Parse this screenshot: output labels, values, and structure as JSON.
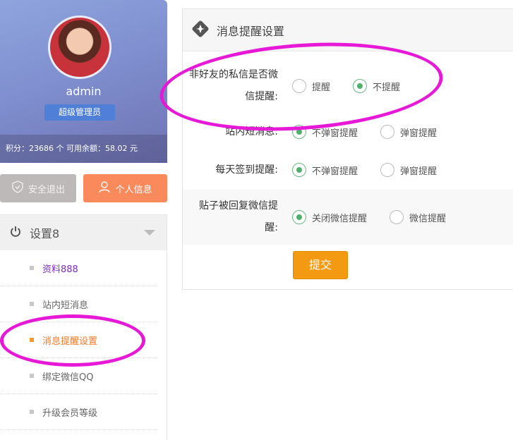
{
  "user": {
    "name": "admin",
    "role": "超级管理员",
    "stats_text": "积分：23686  个   可用余额：58.02   元"
  },
  "buttons": {
    "logout": "安全退出",
    "profile": "个人信息"
  },
  "menu": {
    "title": "设置8",
    "items": [
      {
        "label": "资料888"
      },
      {
        "label": "站内短消息"
      },
      {
        "label": "消息提醒设置"
      },
      {
        "label": "绑定微信QQ"
      },
      {
        "label": "升级会员等级"
      }
    ]
  },
  "panel": {
    "title": "消息提醒设置",
    "rows": [
      {
        "label": "非好友的私信是否微信提醒:",
        "options": [
          "提醒",
          "不提醒"
        ],
        "selected": 1
      },
      {
        "label": "站内短消息:",
        "options": [
          "不弹窗提醒",
          "弹窗提醒"
        ],
        "selected": 0
      },
      {
        "label": "每天签到提醒:",
        "options": [
          "不弹窗提醒",
          "弹窗提醒"
        ],
        "selected": 0
      },
      {
        "label": "贴子被回复微信提醒:",
        "options": [
          "关闭微信提醒",
          "微信提醒"
        ],
        "selected": 0
      }
    ],
    "submit": "提交"
  },
  "colors": {
    "accent_orange": "#f39a12",
    "radio_green": "#4fb06b",
    "annotation_magenta": "#e61ad6"
  }
}
